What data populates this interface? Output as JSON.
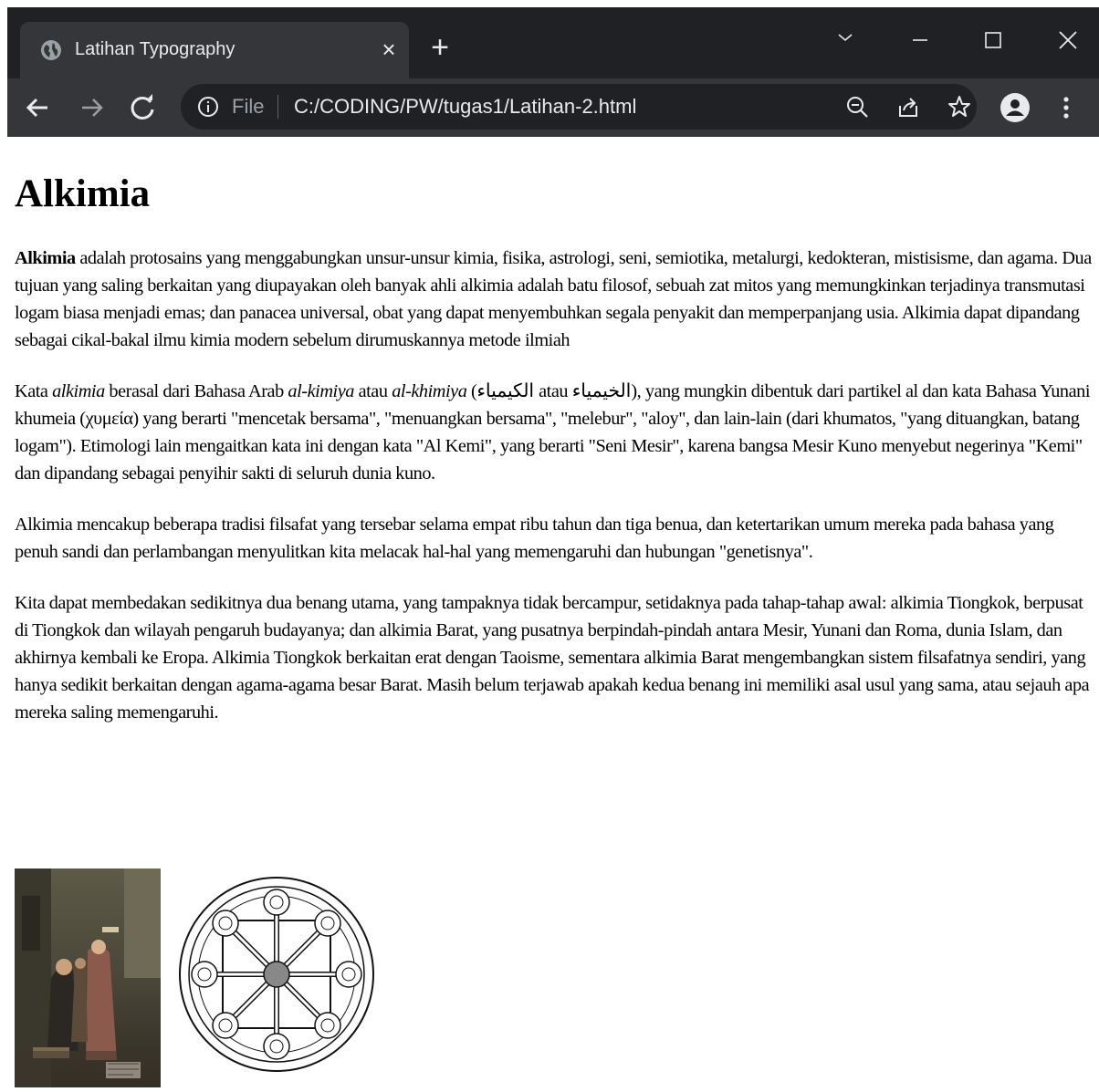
{
  "browser": {
    "tab_title": "Latihan Typography",
    "close_tab": "×",
    "new_tab": "+",
    "omnibox_scheme": "File",
    "url": "C:/CODING/PW/tugas1/Latihan-2.html"
  },
  "page": {
    "heading": "Alkimia",
    "p1": {
      "bold": "Alkimia",
      "rest": " adalah protosains yang menggabungkan unsur-unsur kimia, fisika, astrologi, seni, semiotika, metalurgi, kedokteran, mistisisme, dan agama. Dua tujuan yang saling berkaitan yang diupayakan oleh banyak ahli alkimia adalah batu filosof, sebuah zat mitos yang memungkinkan terjadinya transmutasi logam biasa menjadi emas; dan panacea universal, obat yang dapat menyembuhkan segala penyakit dan memperpanjang usia. Alkimia dapat dipandang sebagai cikal-bakal ilmu kimia modern sebelum dirumuskannya metode ilmiah"
    },
    "p2": {
      "t1": "Kata ",
      "i1": "alkimia",
      "t2": " berasal dari Bahasa Arab ",
      "i2": "al-kimiya",
      "t3": " atau ",
      "i3": "al-khimiya",
      "t4": " (الكيمياء atau الخيمياء), yang mungkin dibentuk dari partikel al dan kata Bahasa Yunani khumeia (χυμεία) yang berarti \"mencetak bersama\", \"menuangkan bersama\", \"melebur\", \"aloy\", dan lain-lain (dari khumatos, \"yang dituangkan, batang logam\"). Etimologi lain mengaitkan kata ini dengan kata \"Al Kemi\", yang berarti \"Seni Mesir\", karena bangsa Mesir Kuno menyebut negerinya \"Kemi\" dan dipandang sebagai penyihir sakti di seluruh dunia kuno."
    },
    "p3": "Alkimia mencakup beberapa tradisi filsafat yang tersebar selama empat ribu tahun dan tiga benua, dan ketertarikan umum mereka pada bahasa yang penuh sandi dan perlambangan menyulitkan kita melacak hal-hal yang memengaruhi dan hubungan \"genetisnya\".",
    "p4": "Kita dapat membedakan sedikitnya dua benang utama, yang tampaknya tidak bercampur, setidaknya pada tahap-tahap awal: alkimia Tiongkok, berpusat di Tiongkok dan wilayah pengaruh budayanya; dan alkimia Barat, yang pusatnya berpindah-pindah antara Mesir, Yunani dan Roma, dunia Islam, dan akhirnya kembali ke Eropa. Alkimia Tiongkok berkaitan erat dengan Taoisme, sementara alkimia Barat mengembangkan sistem filsafatnya sendiri, yang hanya sedikit berkaitan dengan agama-agama besar Barat. Masih belum terjawab apakah kedua benang ini memiliki asal usul yang sama, atau sejauh apa mereka saling memengaruhi."
  },
  "colors": {
    "chrome_bg": "#202124",
    "toolbar_bg": "#35363a",
    "chrome_text": "#e8eaed"
  }
}
